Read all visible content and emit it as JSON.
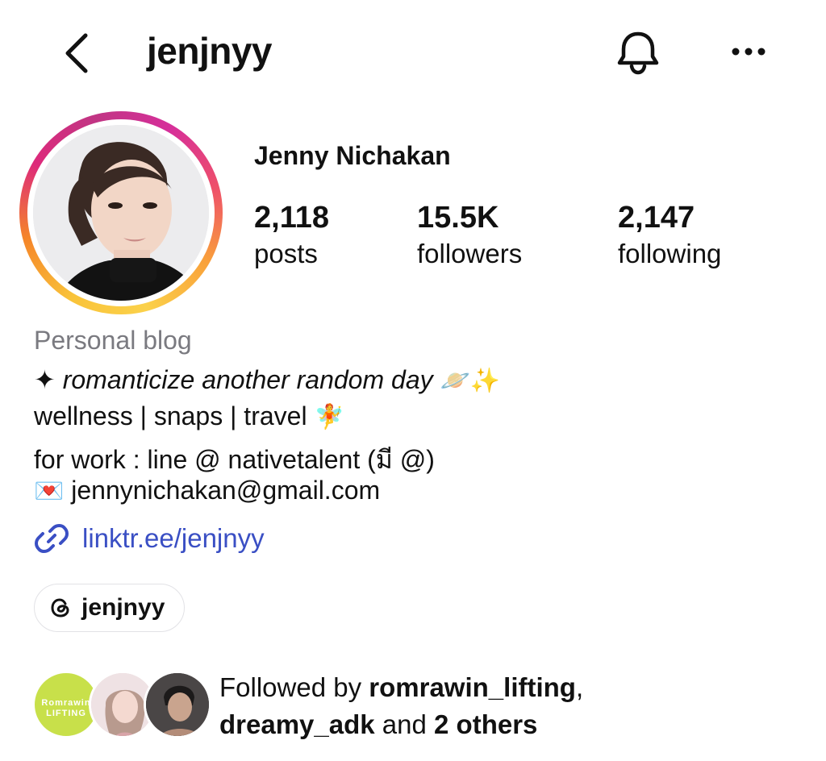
{
  "header": {
    "username": "jenjnyy"
  },
  "profile": {
    "full_name": "Jenny Nichakan",
    "stats": {
      "posts_count": "2,118",
      "posts_label": "posts",
      "followers_count": "15.5K",
      "followers_label": "followers",
      "following_count": "2,147",
      "following_label": "following"
    }
  },
  "bio": {
    "category": "Personal blog",
    "line1_prefix": "✦",
    "line1_text": "romanticize another random day",
    "line1_emoji": "🪐✨",
    "line2_text": "wellness | snaps | travel",
    "line2_emoji": "🧚",
    "line3_text": "for work : line @ nativetalent (มี @)",
    "line4_emoji": "💌",
    "line4_text": "jennynichakan@gmail.com",
    "link": "linktr.ee/jenjnyy"
  },
  "threads_chip": {
    "label": "jenjnyy"
  },
  "followed_by": {
    "prefix": "Followed by ",
    "user1": "romrawin_lifting",
    "comma": ",",
    "user2": "dreamy_adk",
    "and": " and ",
    "others": "2 others",
    "avatar1_text_top": "Romrawin",
    "avatar1_text_bottom": "LIFTING"
  },
  "colors": {
    "link": "#3a4fc4",
    "category": "#7a7a80",
    "ring_start": "#f9c33a",
    "ring_end": "#c13584",
    "lifting_avatar": "#c8e04a"
  }
}
